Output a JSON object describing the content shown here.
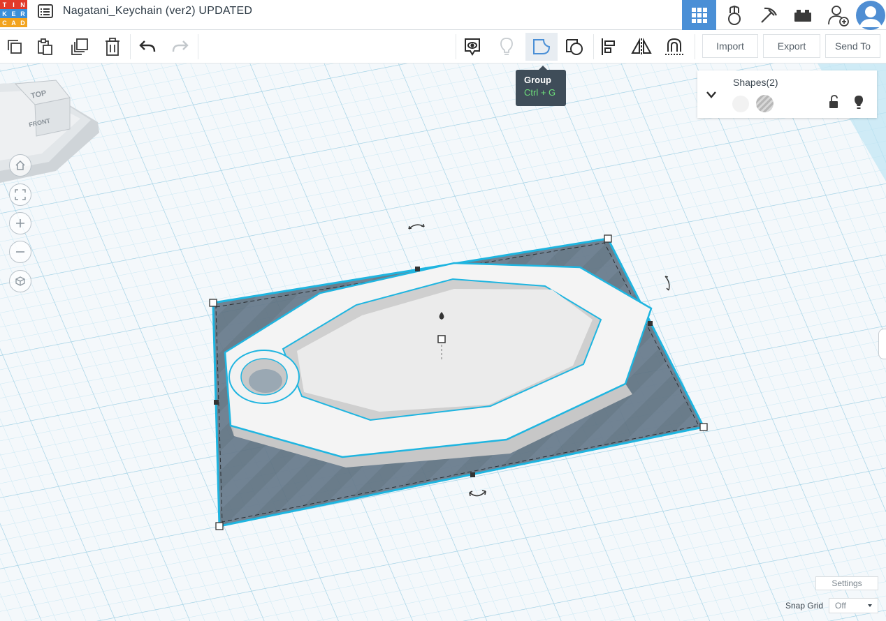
{
  "header": {
    "logo_letters": [
      "T",
      "I",
      "N",
      "K",
      "E",
      "R",
      "C",
      "A",
      "D"
    ],
    "logo_colors": [
      "#e23a2a",
      "#e23a2a",
      "#e23a2a",
      "#3a8fd9",
      "#3a8fd9",
      "#3a8fd9",
      "#f2a31e",
      "#f2a31e",
      "#f2a31e"
    ],
    "doc_title": "Nagatani_Keychain (ver2) UPDATED",
    "nav_icons": [
      "grid-3d-view-icon",
      "bricks-icon",
      "pickaxe-icon",
      "brick-icon",
      "add-user-icon",
      "user-avatar-icon"
    ],
    "active_color": "#4a8fd6"
  },
  "toolbar": {
    "icons": [
      "copy-icon",
      "paste-icon",
      "duplicate-icon",
      "trash-icon",
      "undo-icon",
      "redo-icon",
      "notes-icon",
      "lightbulb-icon",
      "group-icon",
      "ungroup-icon",
      "align-icon",
      "mirror-icon",
      "workplane-magnet-icon"
    ],
    "import_label": "Import",
    "export_label": "Export",
    "send_to_label": "Send To"
  },
  "tooltip": {
    "title": "Group",
    "shortcut": "Ctrl + G",
    "shortcut_color": "#6ee07a"
  },
  "shapes_panel": {
    "title": "Shapes(2)",
    "icons": [
      "chevron-down-icon",
      "lock-open-icon",
      "lightbulb-icon"
    ]
  },
  "view_cube": {
    "top_label": "TOP",
    "front_label": "FRONT"
  },
  "view_controls": [
    "home-icon",
    "fit-view-icon",
    "zoom-in-icon",
    "zoom-out-icon",
    "perspective-icon"
  ],
  "footer": {
    "settings_label": "Settings",
    "snap_grid_label": "Snap Grid",
    "snap_grid_value": "Off"
  },
  "colors": {
    "selection": "#1fb5e0",
    "workplane_grid": "#bfe3f1",
    "hole_fill": "#5b6d7a"
  }
}
